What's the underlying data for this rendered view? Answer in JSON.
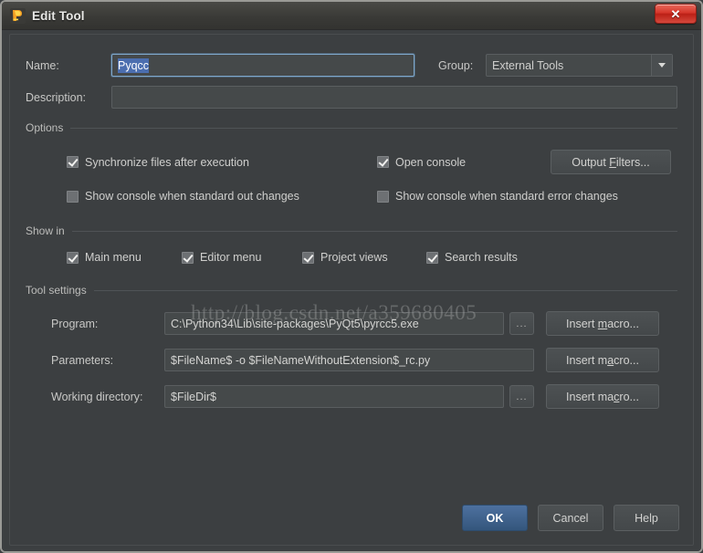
{
  "window": {
    "title": "Edit Tool",
    "icon": "pycharm-icon",
    "close_label": "✕"
  },
  "form": {
    "name_label": "Name:",
    "name_value": "Pyqcc",
    "description_label": "Description:",
    "description_value": "",
    "group_label": "Group:",
    "group_value": "External Tools"
  },
  "options": {
    "title": "Options",
    "items": [
      {
        "label": "Synchronize files after execution",
        "checked": true
      },
      {
        "label": "Open console",
        "checked": true
      },
      {
        "label": "Show console when standard out changes",
        "checked": false
      },
      {
        "label": "Show console when standard error changes",
        "checked": false
      }
    ],
    "output_filters_button": "Output Filters..."
  },
  "show_in": {
    "title": "Show in",
    "items": [
      {
        "label": "Main menu",
        "checked": true
      },
      {
        "label": "Editor menu",
        "checked": true
      },
      {
        "label": "Project views",
        "checked": true
      },
      {
        "label": "Search results",
        "checked": true
      }
    ]
  },
  "tool_settings": {
    "title": "Tool settings",
    "program_label": "Program:",
    "program_value": "C:\\Python34\\Lib\\site-packages\\PyQt5\\pyrcc5.exe",
    "parameters_label": "Parameters:",
    "parameters_value": "$FileName$ -o $FileNameWithoutExtension$_rc.py",
    "working_dir_label": "Working directory:",
    "working_dir_value": "$FileDir$",
    "browse_label": "...",
    "insert_macro_label": "Insert macro..."
  },
  "footer": {
    "ok": "OK",
    "cancel": "Cancel",
    "help": "Help"
  },
  "watermark": "http://blog.csdn.net/a359680405",
  "colors": {
    "dialog_bg": "#3c3f41",
    "field_bg": "#45494a",
    "accent_blue": "#4b6eaf",
    "close_red": "#d6352a",
    "text": "#cfcfcd"
  }
}
